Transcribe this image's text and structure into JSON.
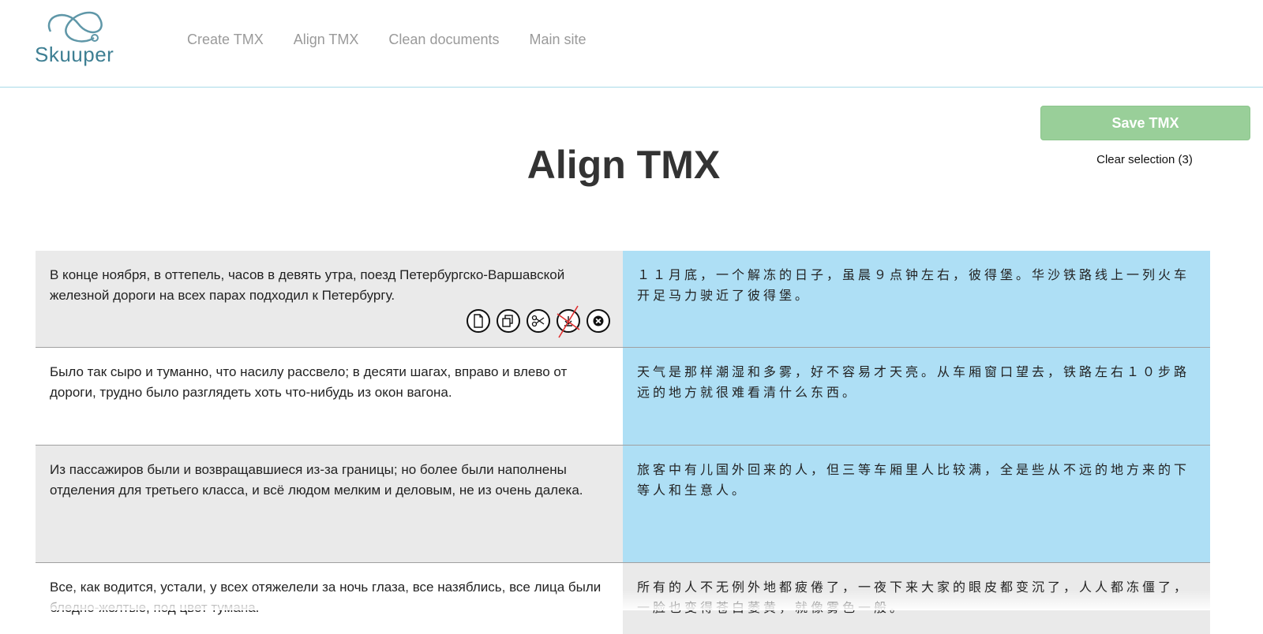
{
  "logo": {
    "text": "Skuuper"
  },
  "nav": {
    "items": [
      "Create TMX",
      "Align TMX",
      "Clean documents",
      "Main site"
    ]
  },
  "actions": {
    "save_label": "Save TMX",
    "clear_label": "Clear selection (3)"
  },
  "page": {
    "title": "Align TMX"
  },
  "colors": {
    "accent_green": "#99cf99",
    "row_grey": "#eaeaea",
    "selected_blue": "#aedff5",
    "logo_teal": "#3e7f93"
  },
  "segment_tools": [
    "new-document-icon",
    "copy-icon",
    "scissors-icon",
    "merge-down-disabled-icon",
    "delete-icon"
  ],
  "rows": [
    {
      "source": "В конце ноября, в оттепель, часов в девять утра, поезд Петербургско-Варшавской железной дороги на всех парах подходил к Петербургу.",
      "target": "１１月底，一个解冻的日子，虽晨９点钟左右，彼得堡。华沙铁路线上一列火车开足马力驶近了彼得堡。"
    },
    {
      "source": "Было так сыро и туманно, что насилу рассвело; в десяти шагах, вправо и влево от дороги, трудно было разглядеть хоть что-нибудь из окон вагона.",
      "target": "天气是那样潮湿和多雾，好不容易才天亮。从车厢窗口望去，铁路左右１０步路远的地方就很难看清什么东西。"
    },
    {
      "source": "Из пассажиров были и возвращавшиеся из-за границы; но более были наполнены отделения для третьего класса, и всё людом мелким и деловым, не из очень далека.",
      "target": "旅客中有儿国外回来的人，但三等车厢里人比较满，全是些从不远的地方来的下等人和生意人。"
    },
    {
      "source": "Все, как водится, устали, у всех отяжелели за ночь глаза, все назяблись, все лица были бледно-желтые, под цвет тумана.",
      "target": "所有的人不无例外地都疲倦了，一夜下来大家的眼皮都变沉了，人人都冻僵了，一脸也变得苍白萎黄，就像雾色一般。"
    }
  ]
}
